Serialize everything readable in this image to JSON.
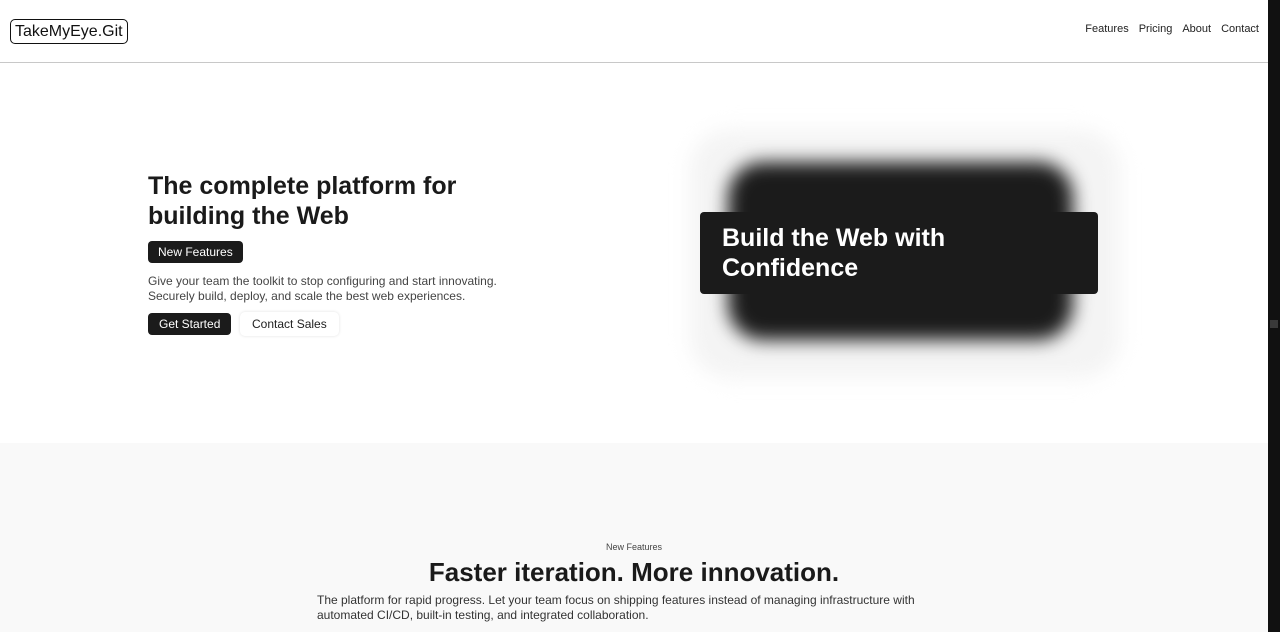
{
  "header": {
    "logo": "TakeMyEye.Git",
    "nav": [
      "Features",
      "Pricing",
      "About",
      "Contact"
    ]
  },
  "hero": {
    "title": "The complete platform for building the Web",
    "badge": "New Features",
    "description_line1": "Give your team the toolkit to stop configuring and start innovating.",
    "description_line2": "Securely build, deploy, and scale the best web experiences.",
    "primary_button": "Get Started",
    "secondary_button": "Contact Sales"
  },
  "visual": {
    "card_line1": "Build the Web with",
    "card_line2": "Confidence"
  },
  "features": {
    "eyebrow": "New Features",
    "title": "Faster iteration. More innovation.",
    "description_line1": "The platform for rapid progress. Let your team focus on shipping features instead of managing infrastructure with",
    "description_line2": "automated CI/CD, built-in testing, and integrated collaboration."
  }
}
